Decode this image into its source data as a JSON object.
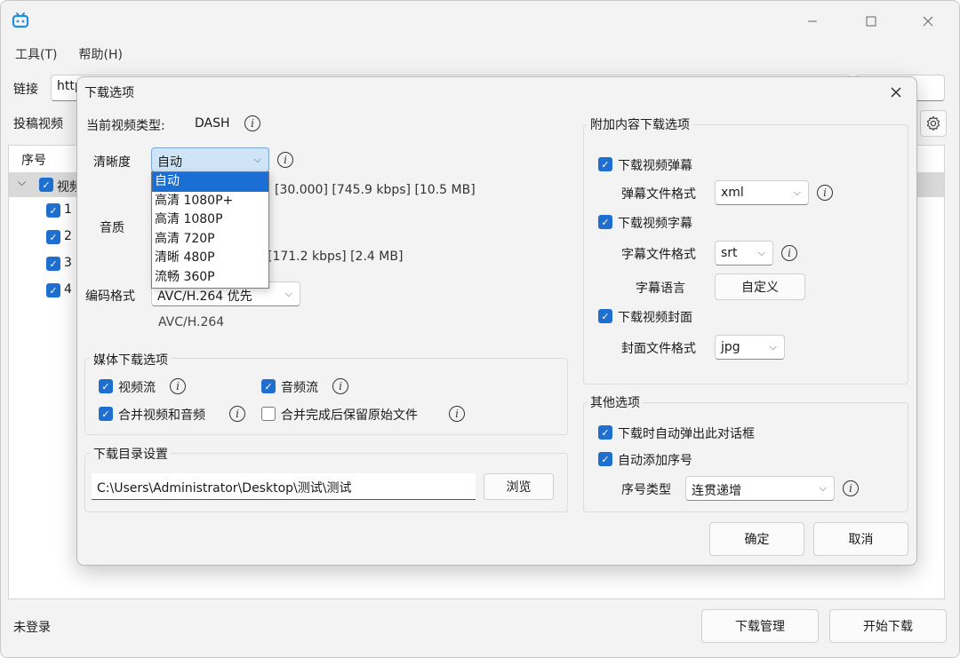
{
  "window": {
    "menu": [
      "工具(T)",
      "帮助(H)"
    ]
  },
  "main": {
    "link_label": "链接",
    "link_value": "http",
    "submission_label": "投稿视频",
    "tree_header": "序号",
    "tree_root": "视频",
    "tree_items": [
      "1",
      "2",
      "3",
      "4"
    ],
    "status": "未登录",
    "download_manager": "下载管理",
    "start_download": "开始下载"
  },
  "dialog": {
    "title": "下载选项",
    "video_type_label": "当前视频类型:",
    "video_type_value": "DASH",
    "quality_label": "清晰度",
    "quality_selected": "自动",
    "quality_options": [
      "自动",
      "高清 1080P+",
      "高清 1080P",
      "高清 720P",
      "清晰 480P",
      "流畅 360P"
    ],
    "video_info": "[30.000]  [745.9 kbps]  [10.5 MB]",
    "audio_label": "音质",
    "audio_info": "[171.2 kbps]  [2.4 MB]",
    "codec_label": "编码格式",
    "codec_selected": "AVC/H.264 优先",
    "codec_info": "AVC/H.264",
    "media_group": {
      "title": "媒体下载选项",
      "video_stream": "视频流",
      "audio_stream": "音频流",
      "merge": "合并视频和音频",
      "keep_original": "合并完成后保留原始文件"
    },
    "dir_group": {
      "title": "下载目录设置",
      "path": "C:\\Users\\Administrator\\Desktop\\测试\\测试",
      "browse": "浏览"
    },
    "extra_group": {
      "title": "附加内容下载选项",
      "danmaku": "下载视频弹幕",
      "danmaku_format_label": "弹幕文件格式",
      "danmaku_format": "xml",
      "subtitle": "下载视频字幕",
      "subtitle_format_label": "字幕文件格式",
      "subtitle_format": "srt",
      "subtitle_lang_label": "字幕语言",
      "subtitle_lang_button": "自定义",
      "cover": "下载视频封面",
      "cover_format_label": "封面文件格式",
      "cover_format": "jpg"
    },
    "other_group": {
      "title": "其他选项",
      "auto_popup": "下载时自动弹出此对话框",
      "auto_number": "自动添加序号",
      "number_type_label": "序号类型",
      "number_type": "连贯递增"
    },
    "ok": "确定",
    "cancel": "取消"
  },
  "colors": {
    "accent": "#1f6fd1",
    "selection": "#1a6ed4"
  }
}
